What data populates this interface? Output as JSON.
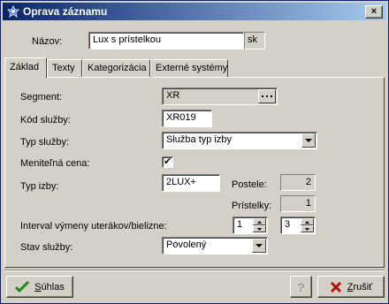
{
  "window": {
    "title": "Oprava záznamu",
    "close_label": "×"
  },
  "nazov": {
    "label": "Názov:",
    "value": "Lux s prístelkou",
    "lang": "sk"
  },
  "tabs": [
    {
      "label": "Základ"
    },
    {
      "label": "Texty"
    },
    {
      "label": "Kategorizácia"
    },
    {
      "label": "Externé systémy"
    }
  ],
  "form": {
    "segment": {
      "label": "Segment:",
      "value": "XR"
    },
    "kod_sluzby": {
      "label": "Kód služby:",
      "value": "XR019"
    },
    "typ_sluzby": {
      "label": "Typ služby:",
      "value": "Služba typ izby"
    },
    "menitelna_cena": {
      "label": "Meniteľná cena:",
      "checked": true,
      "mark": "✔"
    },
    "typ_izby": {
      "label": "Typ izby:",
      "value": "2LUX+"
    },
    "postele": {
      "label": "Postele:",
      "value": "2"
    },
    "pristelky": {
      "label": "Prístelky:",
      "value": "1"
    },
    "interval": {
      "label": "Interval výmeny uterákov/bielizne:",
      "value1": "1",
      "value2": "3"
    },
    "stav_sluzby": {
      "label": "Stav služby:",
      "value": "Povolený"
    }
  },
  "buttons": {
    "suhlas": {
      "label_first": "S",
      "label_rest": "úhlas"
    },
    "help": {
      "label": "?"
    },
    "zrusit": {
      "label_first": "Z",
      "label_rest": "rušiť"
    }
  }
}
